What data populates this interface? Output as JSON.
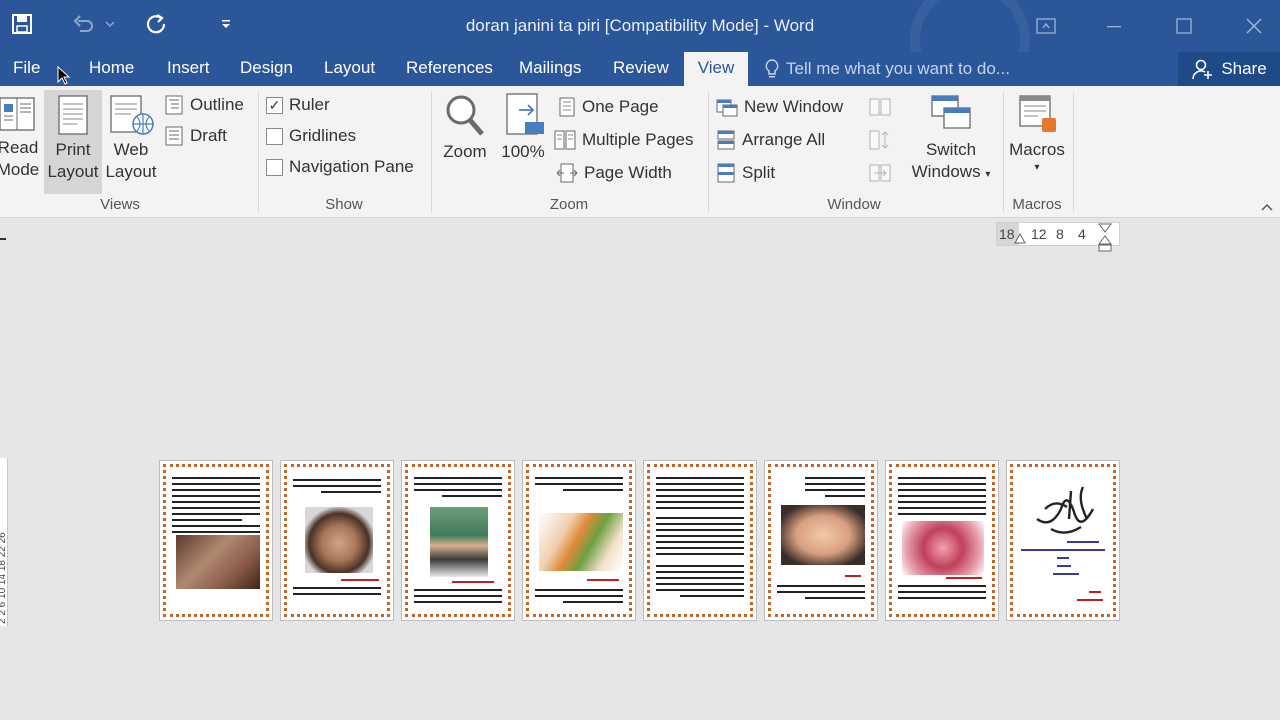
{
  "window": {
    "title": "doran janini ta piri [Compatibility Mode] - Word"
  },
  "qat": {
    "save_icon": "save-icon",
    "undo_icon": "undo-icon",
    "redo_icon": "repeat-icon",
    "customize_icon": "customize-qat-icon"
  },
  "tabs": [
    {
      "label": "File"
    },
    {
      "label": "Home"
    },
    {
      "label": "Insert"
    },
    {
      "label": "Design"
    },
    {
      "label": "Layout"
    },
    {
      "label": "References"
    },
    {
      "label": "Mailings"
    },
    {
      "label": "Review"
    },
    {
      "label": "View"
    }
  ],
  "tell_me": {
    "placeholder": "Tell me what you want to do..."
  },
  "share": {
    "label": "Share"
  },
  "ribbon": {
    "views": {
      "label": "Views",
      "read_mode": [
        "Read",
        "Mode"
      ],
      "print_layout": [
        "Print",
        "Layout"
      ],
      "web_layout": [
        "Web",
        "Layout"
      ],
      "outline": "Outline",
      "draft": "Draft"
    },
    "show": {
      "label": "Show",
      "ruler": "Ruler",
      "gridlines": "Gridlines",
      "navigation_pane": "Navigation Pane"
    },
    "zoom": {
      "label": "Zoom",
      "zoom": "Zoom",
      "hundred": "100%",
      "hundred_badge": "100",
      "one_page": "One Page",
      "multiple_pages": "Multiple Pages",
      "page_width": "Page Width"
    },
    "window": {
      "label": "Window",
      "new_window": "New Window",
      "arrange_all": "Arrange All",
      "split": "Split",
      "switch_windows": [
        "Switch",
        "Windows"
      ]
    },
    "macros": {
      "label": "Macros",
      "macros": "Macros"
    }
  },
  "ruler": {
    "ticks": [
      "18",
      "12",
      "8",
      "4"
    ]
  },
  "vruler": {
    "ticks": "2  2  6 10 14 18 22 26"
  },
  "colors": {
    "title_bar": "#2b579a",
    "ribbon": "#f3f3f3",
    "page_border": "#c0662a"
  },
  "pages": [
    {
      "image": "old-man-photo"
    },
    {
      "image": "young-man-photo"
    },
    {
      "image": "boy-photo"
    },
    {
      "image": "girl-photo"
    },
    {
      "image": "text-only"
    },
    {
      "image": "baby-photo"
    },
    {
      "image": "fetus-photo"
    },
    {
      "image": "calligraphy-cover"
    }
  ]
}
